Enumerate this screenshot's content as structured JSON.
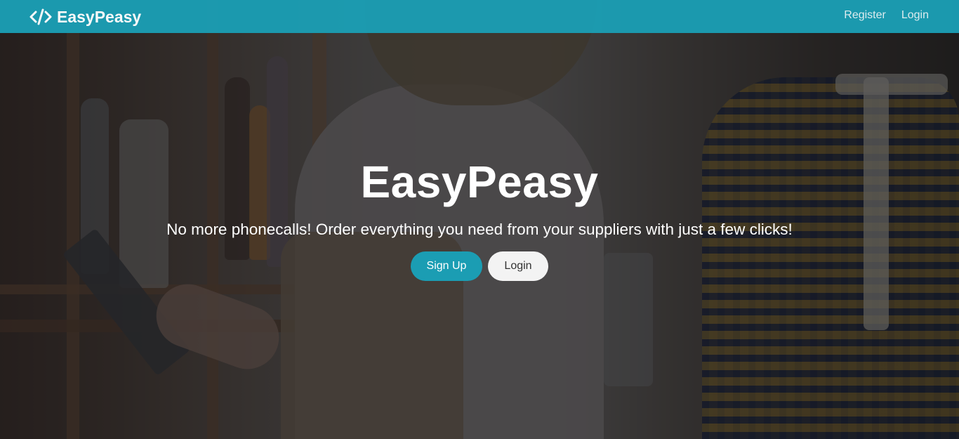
{
  "navbar": {
    "brand_name": "EasyPeasy",
    "brand_icon": "code-icon",
    "links": [
      {
        "label": "Register"
      },
      {
        "label": "Login"
      }
    ],
    "color": "#1b9db3"
  },
  "hero": {
    "title": "EasyPeasy",
    "subtitle": "No more phonecalls! Order everything you need from your suppliers with just a few clicks!",
    "buttons": {
      "signup_label": "Sign Up",
      "login_label": "Login"
    }
  }
}
